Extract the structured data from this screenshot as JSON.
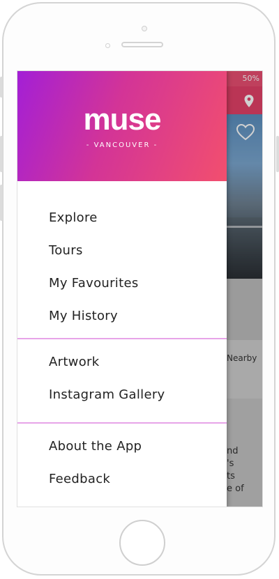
{
  "status_bar": {
    "battery": "50%"
  },
  "drawer": {
    "logo": "muse",
    "logo_subtitle": "- VANCOUVER -",
    "section_main": [
      "Explore",
      "Tours",
      "My Favourites",
      "My History"
    ],
    "section_media": [
      "Artwork",
      "Instagram Gallery"
    ],
    "section_info": [
      "About the App",
      "Feedback"
    ]
  },
  "background_app": {
    "nearby_label": "Nearby",
    "partial_text": [
      "nd",
      "'s",
      "ts",
      "e of"
    ]
  },
  "icons": {
    "header_pin": "map-pin-icon",
    "favourite": "heart-icon"
  },
  "colors": {
    "gradient_start": "#a31fd6",
    "gradient_end": "#f24f6e",
    "divider": "#e7a4e8"
  }
}
